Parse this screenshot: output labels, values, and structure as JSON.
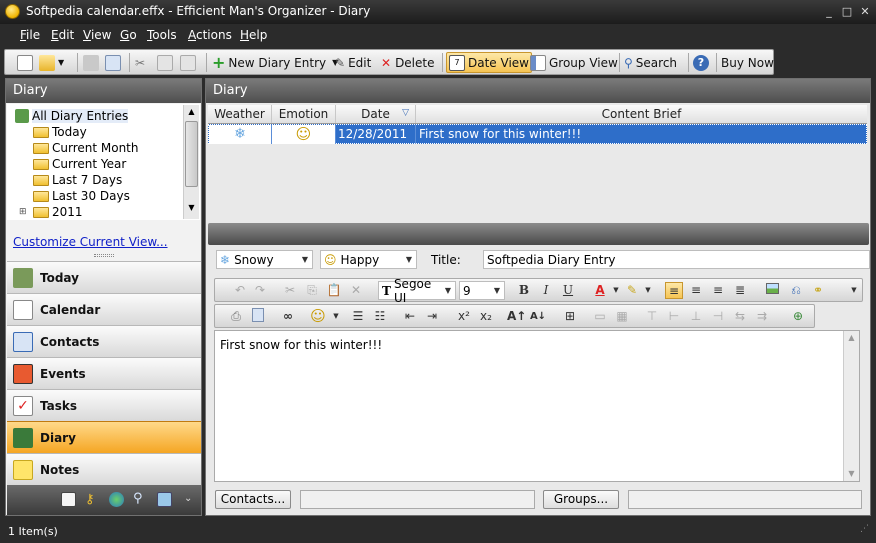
{
  "window": {
    "title": "Softpedia calendar.effx - Efficient Man's Organizer - Diary",
    "minimize": "_",
    "maximize": "□",
    "close": "✕"
  },
  "menu": [
    "File",
    "Edit",
    "View",
    "Go",
    "Tools",
    "Actions",
    "Help"
  ],
  "toolbar": {
    "new_diary_entry": "New Diary Entry",
    "edit": "Edit",
    "delete": "Delete",
    "date_view": "Date View",
    "group_view": "Group View",
    "search": "Search",
    "buy_now": "Buy Now",
    "help": "?"
  },
  "left_panel": {
    "title": "Diary",
    "tree": [
      "All Diary Entries",
      "Today",
      "Current Month",
      "Current Year",
      "Last 7 Days",
      "Last 30 Days",
      "2011"
    ],
    "customize_link": "Customize Current View...",
    "nav": [
      "Today",
      "Calendar",
      "Contacts",
      "Events",
      "Tasks",
      "Diary",
      "Notes"
    ]
  },
  "right_panel": {
    "title": "Diary",
    "columns": [
      "Weather",
      "Emotion",
      "Date",
      "Content Brief"
    ],
    "rows": [
      {
        "weather": "❄",
        "emotion": "☺",
        "date": "12/28/2011",
        "brief": "First snow for this winter!!!"
      }
    ]
  },
  "entry": {
    "weather": "Snowy",
    "emotion": "Happy",
    "title_label": "Title:",
    "title_value": "Softpedia Diary Entry",
    "font": "Segoe UI",
    "font_size": "9",
    "content": "First snow for this winter!!!"
  },
  "bottom": {
    "contacts_button": "Contacts...",
    "groups_button": "Groups..."
  },
  "status": {
    "items": "1 Item(s)"
  }
}
